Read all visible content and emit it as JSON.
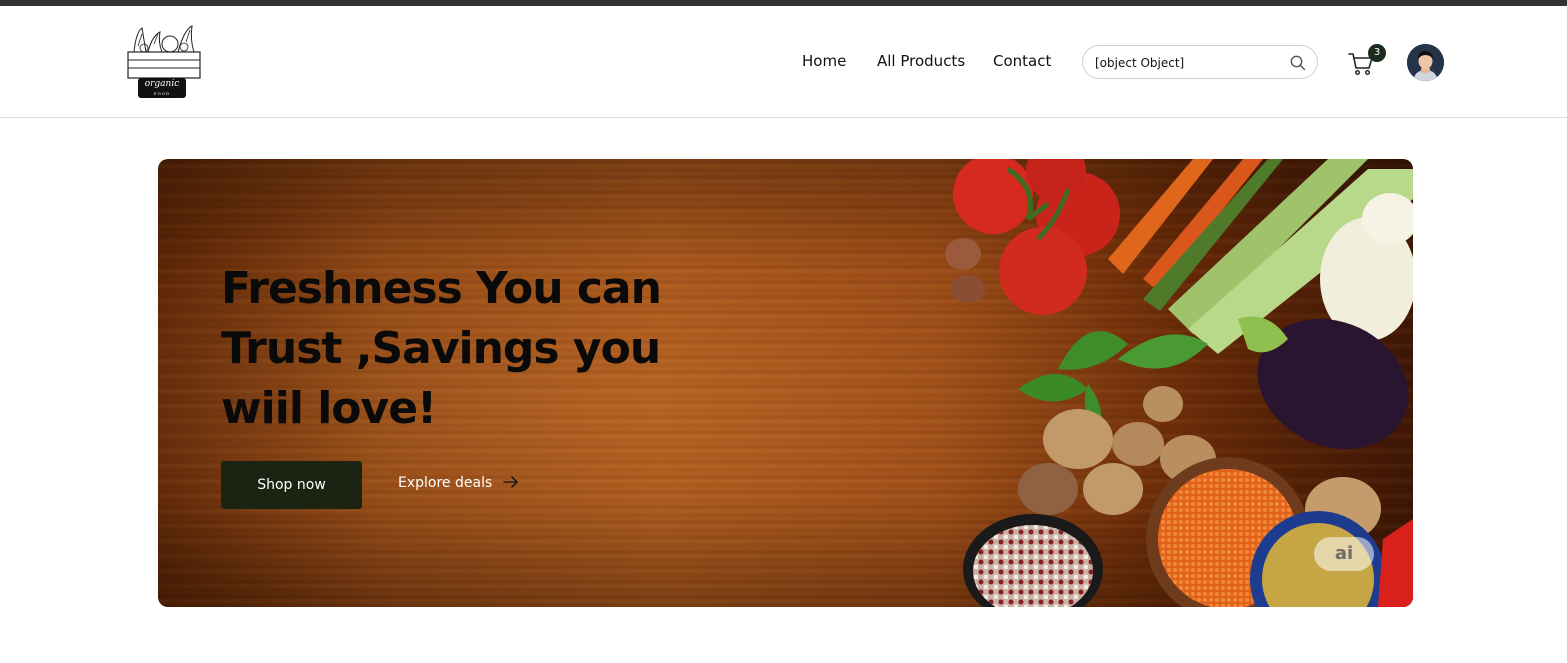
{
  "header": {
    "logo": {
      "alt_text": "organic food logo",
      "badge_text": "organic",
      "badge_subtext": "FOOD"
    },
    "nav": [
      {
        "label": "Home"
      },
      {
        "label": "All Products"
      },
      {
        "label": "Contact"
      }
    ],
    "search": {
      "value": "[object Object]"
    },
    "cart": {
      "count": "3"
    }
  },
  "hero": {
    "title": "Freshness You can Trust ,Savings you wiil love!",
    "primary_cta": "Shop now",
    "secondary_cta": "Explore deals",
    "watermark": "ai"
  },
  "icons": {
    "search": "search-icon",
    "cart": "cart-icon",
    "arrow": "arrow-right-icon",
    "avatar": "user-avatar"
  },
  "colors": {
    "top_strip": "#333333",
    "primary_button": "#1b2412",
    "cart_badge": "#1b2b1e"
  }
}
